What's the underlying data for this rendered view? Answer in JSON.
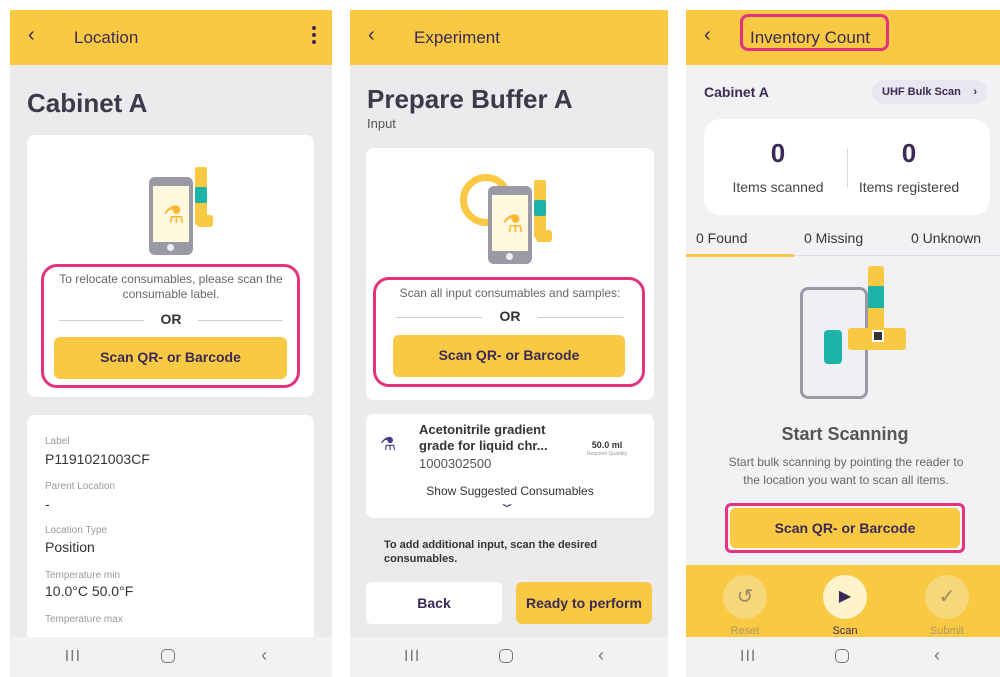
{
  "screens": [
    {
      "appbar_title": "Location",
      "back_glyph": "‹",
      "page_title": "Cabinet A",
      "scan_message": "To relocate consumables, please scan the consumable label.",
      "or_text": "OR",
      "scan_button": "Scan QR- or Barcode",
      "fields": [
        {
          "label": "Label",
          "value": "P1191021003CF"
        },
        {
          "label": "Parent Location",
          "value": "-"
        },
        {
          "label": "Location Type",
          "value": "Position"
        },
        {
          "label": "Temperature min",
          "value": "10.0°C   50.0°F"
        },
        {
          "label": "Temperature max",
          "value": ""
        }
      ]
    },
    {
      "appbar_title": "Experiment",
      "back_glyph": "‹",
      "page_title": "Prepare Buffer A",
      "subtitle": "Input",
      "scan_message": "Scan all input consumables and samples:",
      "or_text": "OR",
      "scan_button": "Scan QR- or Barcode",
      "item": {
        "name": "Acetonitrile gradient grade for liquid chr...",
        "code": "1000302500",
        "quantity": "50.0 ml",
        "quantity_label": "Required Quantity",
        "show_suggested": "Show Suggested Consumables"
      },
      "hint": "To add additional input, scan the desired consumables.",
      "back_button": "Back",
      "perform_button": "Ready to perform"
    },
    {
      "appbar_title": "Inventory Count",
      "back_glyph": "‹",
      "location": "Cabinet A",
      "uhf_button": "UHF Bulk Scan",
      "items_scanned_count": "0",
      "items_scanned_label": "Items scanned",
      "items_registered_count": "0",
      "items_registered_label": "Items registered",
      "tabs": [
        "0 Found",
        "0 Missing",
        "0 Unknown"
      ],
      "start_title": "Start Scanning",
      "start_desc": "Start bulk scanning by pointing the reader to the location you want to scan all items.",
      "scan_button": "Scan QR- or Barcode",
      "actions": [
        {
          "label": "Reset",
          "icon": "reset-icon"
        },
        {
          "label": "Scan",
          "icon": "play-icon"
        },
        {
          "label": "Submit",
          "icon": "check-icon"
        }
      ]
    }
  ],
  "nav_bar": {
    "recents": "III",
    "back": "‹"
  },
  "colors": {
    "accent": "#f9c944",
    "highlight": "#e2337f",
    "brand_text": "#3a2a55",
    "teal": "#1db3a7"
  }
}
